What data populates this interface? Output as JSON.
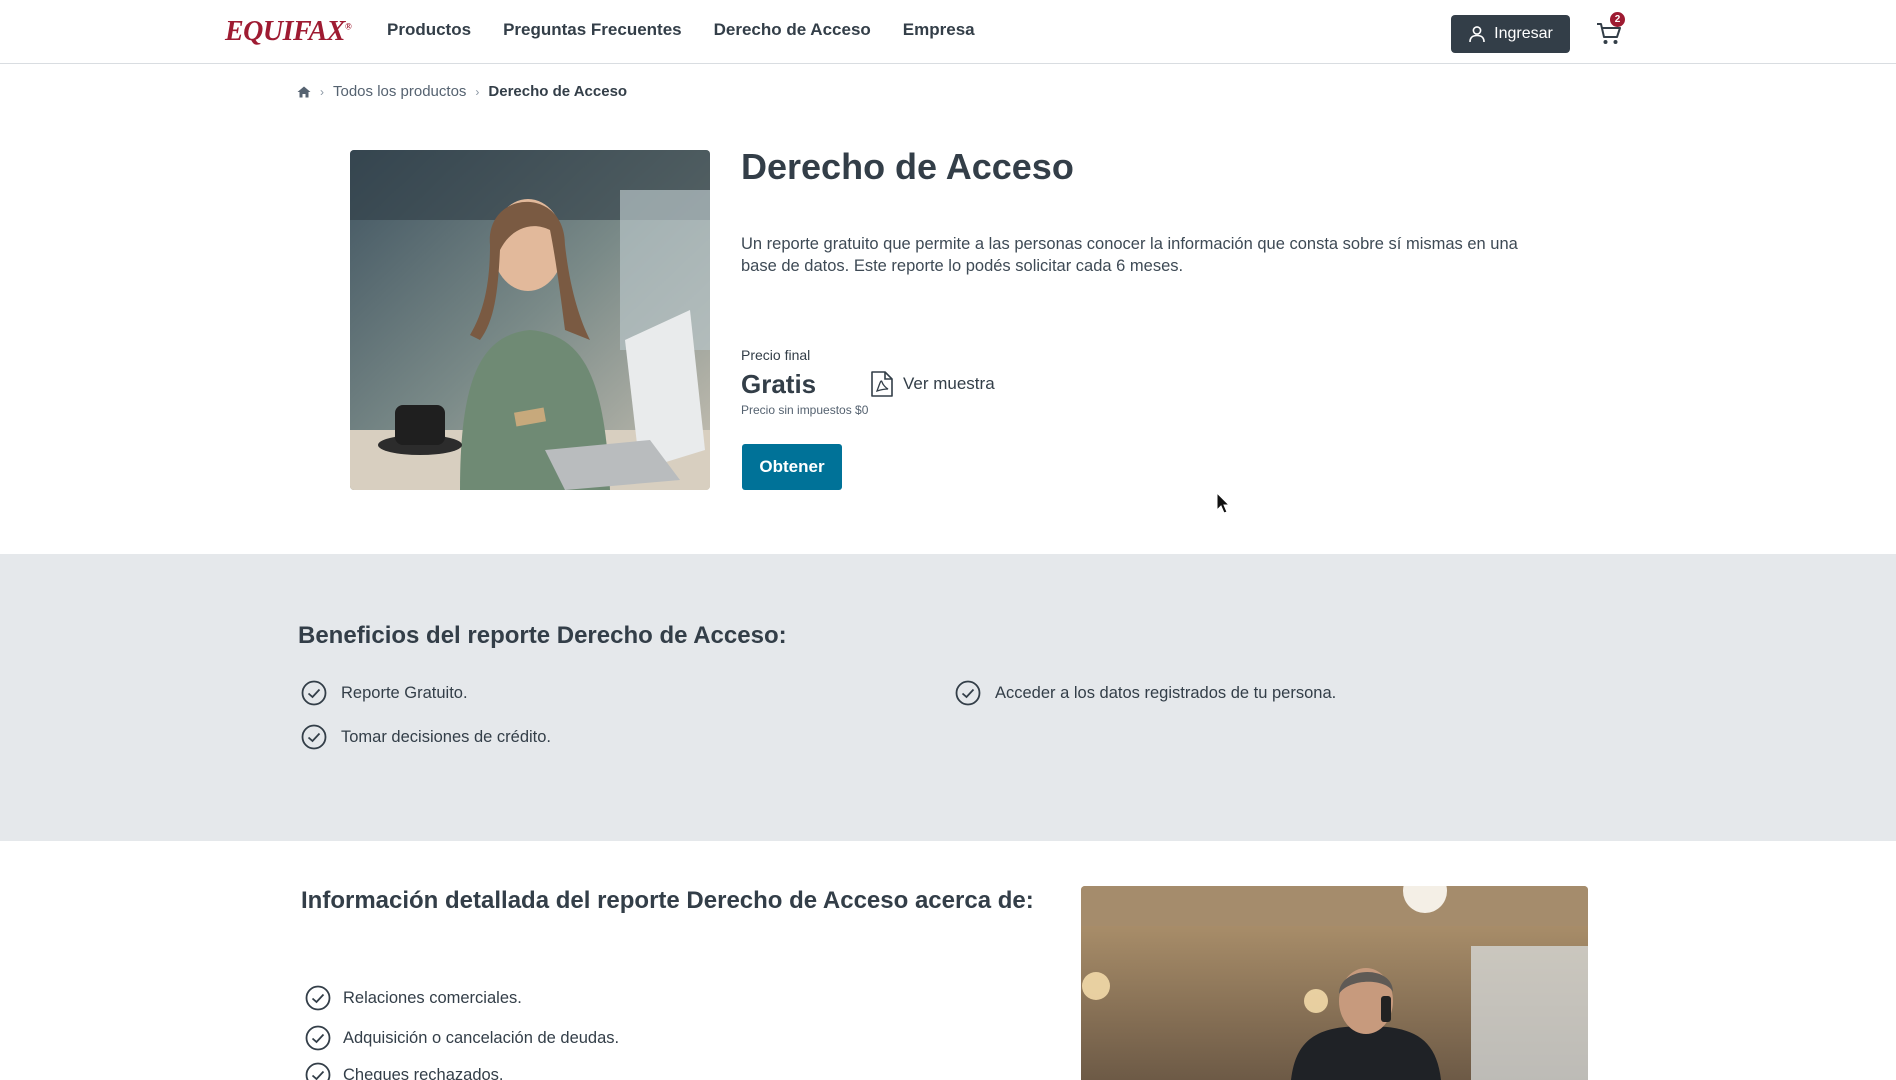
{
  "header": {
    "logo": "EQUIFAX",
    "nav": [
      "Productos",
      "Preguntas Frecuentes",
      "Derecho de Acceso",
      "Empresa"
    ],
    "login_label": "Ingresar",
    "cart_count": "2"
  },
  "breadcrumb": {
    "items": [
      "Todos los productos"
    ],
    "current": "Derecho de Acceso"
  },
  "product": {
    "title": "Derecho de Acceso",
    "description": "Un reporte gratuito que permite a las personas conocer la información que consta sobre sí mismas en una base de datos. Este reporte lo podés solicitar cada 6 meses.",
    "price_label": "Precio final",
    "price": "Gratis",
    "price_note": "Precio sin impuestos $0",
    "sample_label": "Ver muestra",
    "cta_label": "Obtener"
  },
  "benefits": {
    "title": "Beneficios del reporte Derecho de Acceso:",
    "items": [
      "Reporte Gratuito.",
      "Acceder a los datos registrados de tu persona.",
      "Tomar decisiones de crédito."
    ]
  },
  "details": {
    "title": "Información detallada del reporte Derecho de Acceso acerca de:",
    "items": [
      "Relaciones comerciales.",
      "Adquisición o cancelación de deudas.",
      "Cheques rechazados."
    ]
  },
  "colors": {
    "brand": "#9e1b32",
    "primary_button": "#007298",
    "dark": "#333e48",
    "section_bg": "#e5e8eb"
  }
}
